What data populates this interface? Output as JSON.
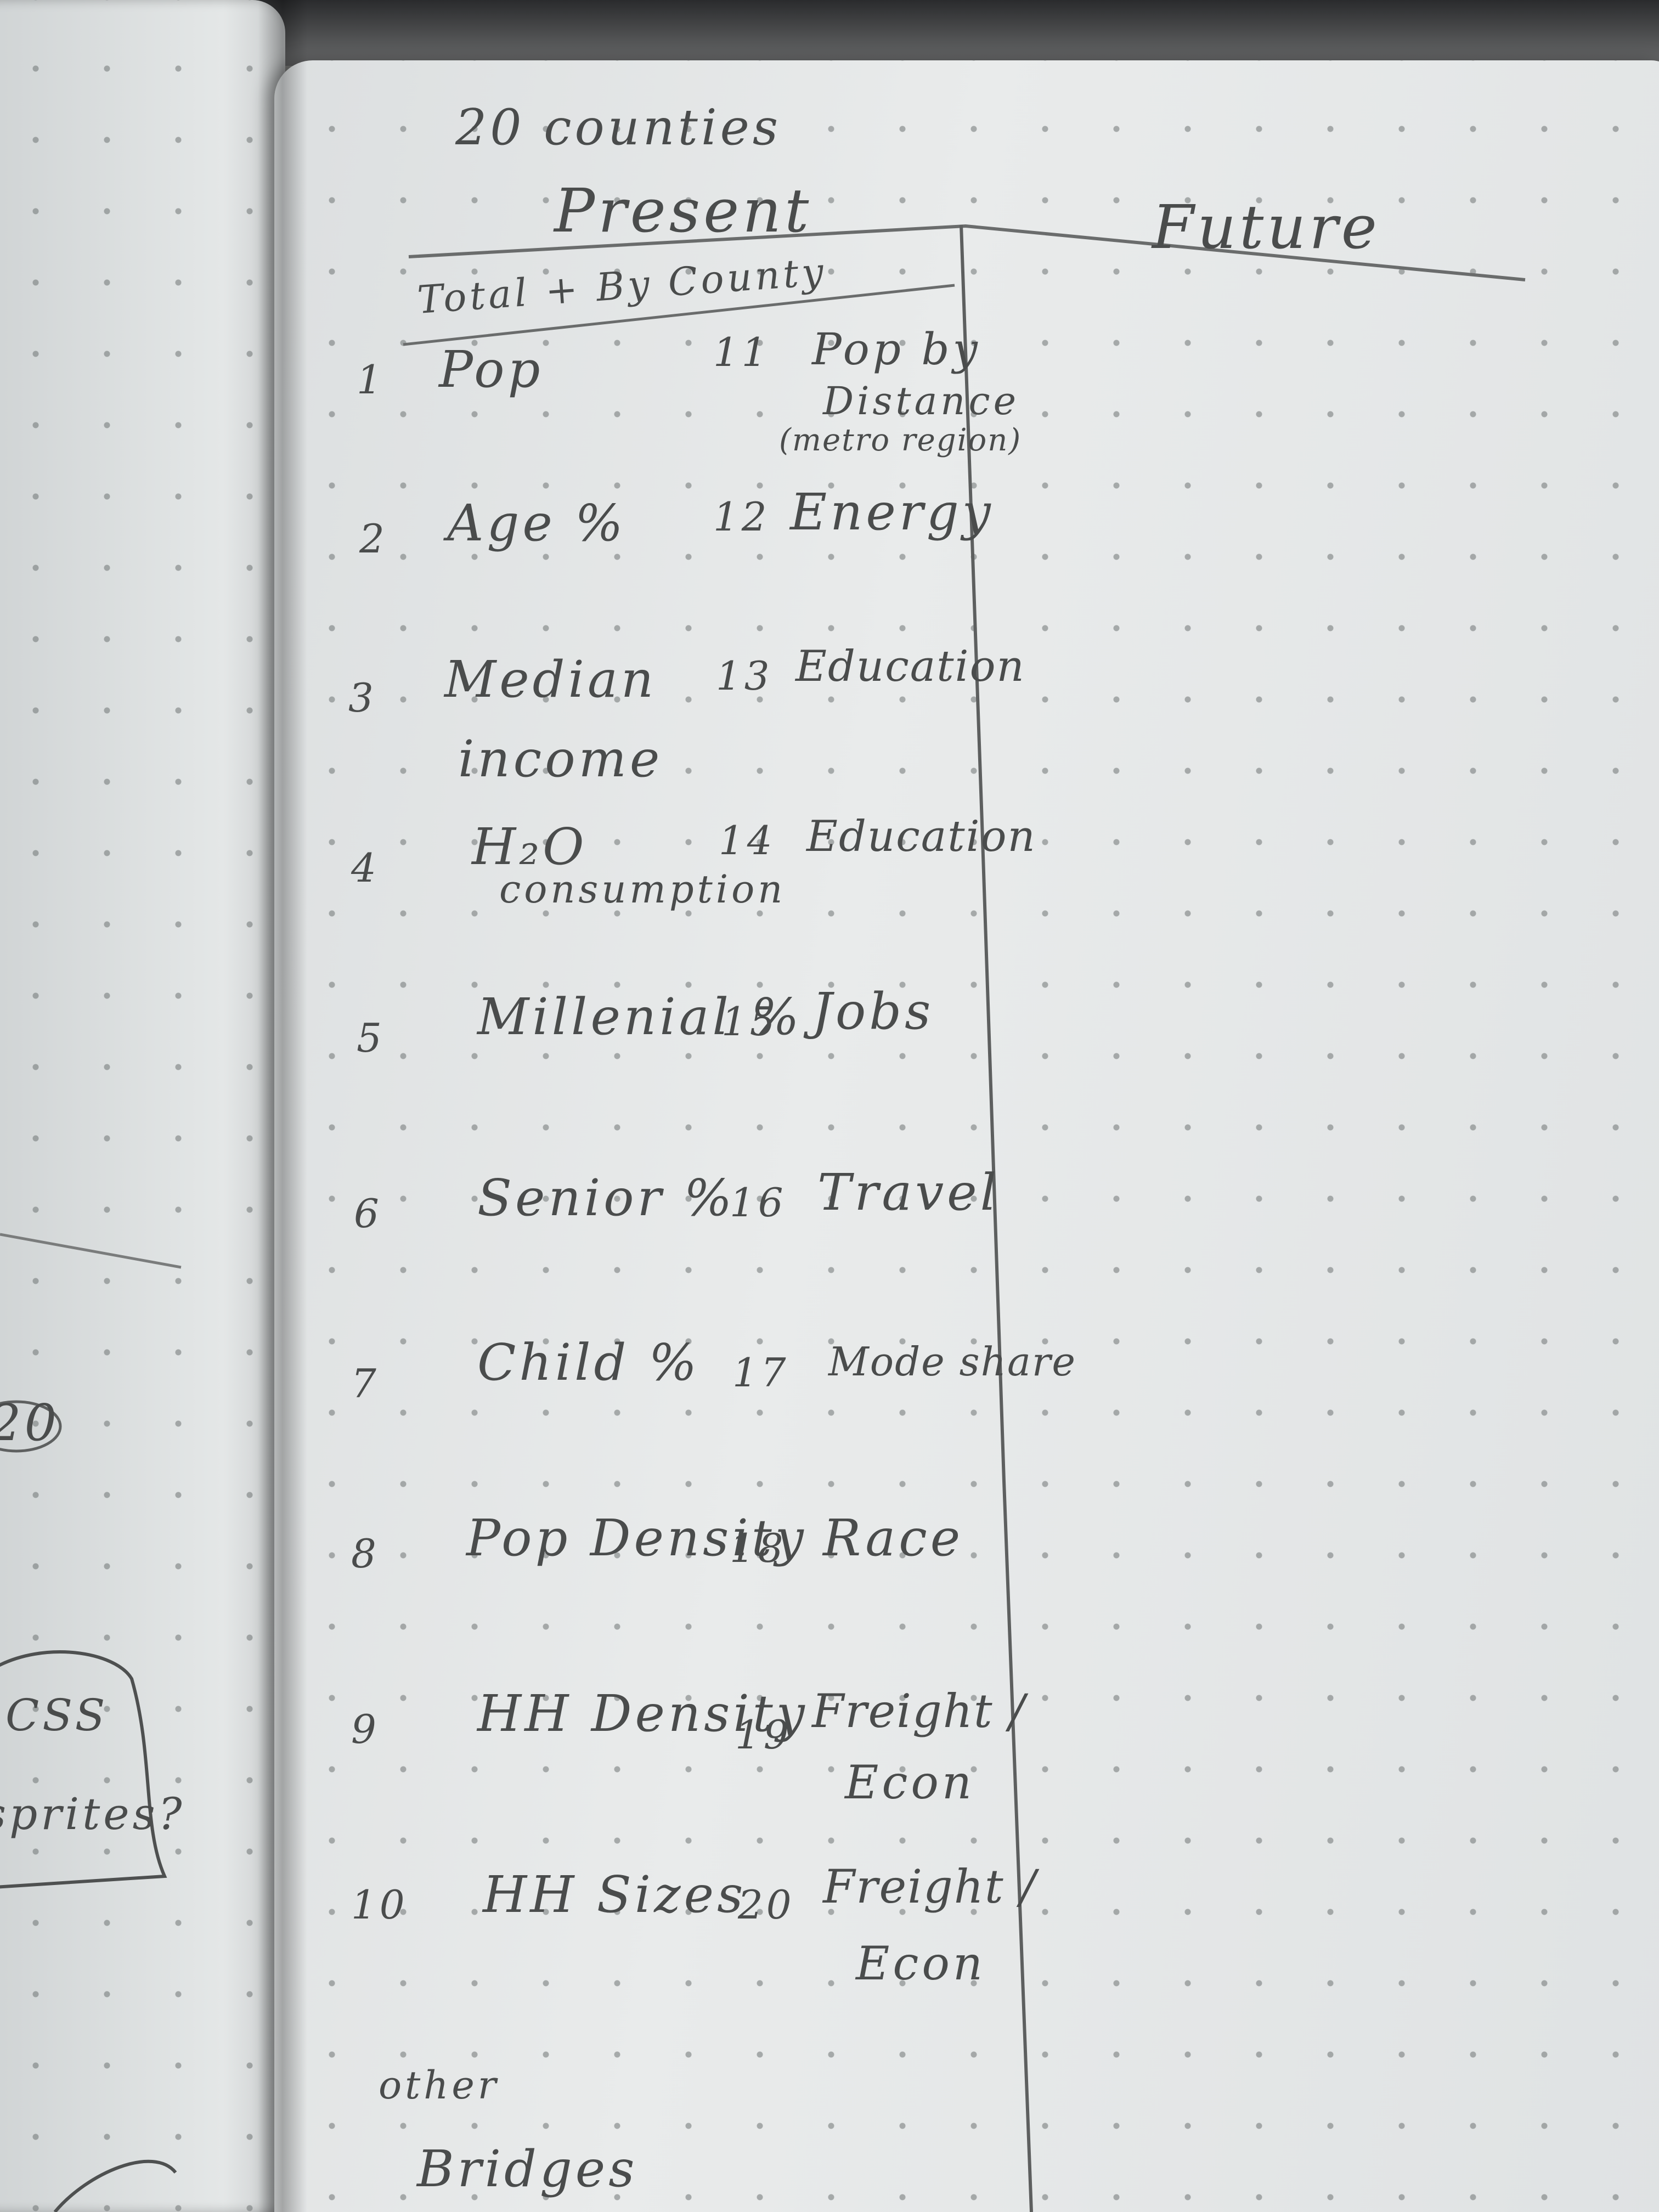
{
  "notebook": {
    "heading": "20 counties",
    "column_present": "Present",
    "column_future": "Future",
    "subheading": "Total + By County",
    "items": [
      {
        "num": "1",
        "label": "Pop"
      },
      {
        "num": "2",
        "label": "Age %"
      },
      {
        "num": "3",
        "label": "Median",
        "label2": "income"
      },
      {
        "num": "4",
        "label": "H₂O",
        "label2": "consumption"
      },
      {
        "num": "5",
        "label": "Millenial %"
      },
      {
        "num": "6",
        "label": "Senior %"
      },
      {
        "num": "7",
        "label": "Child %"
      },
      {
        "num": "8",
        "label": "Pop Density"
      },
      {
        "num": "9",
        "label": "HH Density"
      },
      {
        "num": "10",
        "label": "HH Sizes"
      },
      {
        "num": "11",
        "label": "Pop by",
        "label2": "Distance",
        "label3": "(metro region)"
      },
      {
        "num": "12",
        "label": "Energy"
      },
      {
        "num": "13",
        "label": "Education"
      },
      {
        "num": "14",
        "label": "Education"
      },
      {
        "num": "15",
        "label": "Jobs"
      },
      {
        "num": "16",
        "label": "Travel"
      },
      {
        "num": "17",
        "label": "Mode share"
      },
      {
        "num": "18",
        "label": "Race"
      },
      {
        "num": "19",
        "label": "Freight /",
        "label2": "Econ"
      },
      {
        "num": "20",
        "label": "Freight /",
        "label2": "Econ"
      }
    ],
    "footer_other": "other",
    "footer_bridges": "Bridges",
    "left_page_fragments": [
      "20",
      "CSS",
      "sprites?"
    ]
  }
}
